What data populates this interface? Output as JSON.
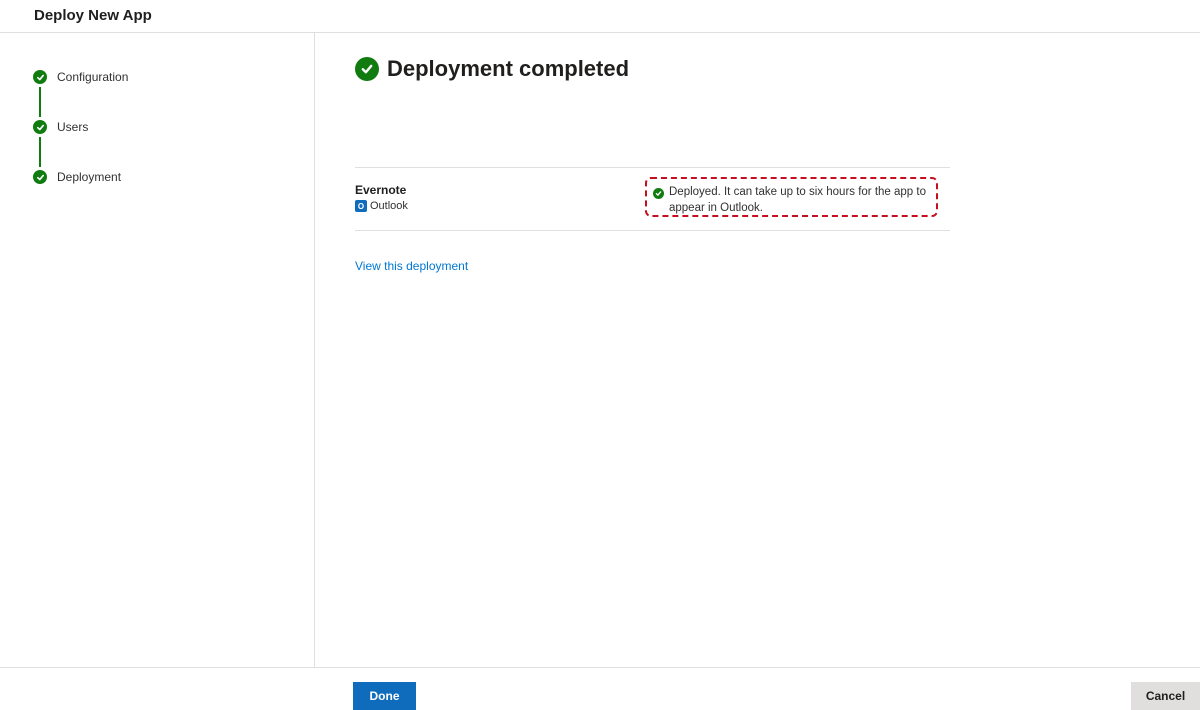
{
  "header": {
    "title": "Deploy New App"
  },
  "steps": [
    {
      "label": "Configuration",
      "icon": "check-circle-icon",
      "status": "complete"
    },
    {
      "label": "Users",
      "icon": "check-circle-icon",
      "status": "complete"
    },
    {
      "label": "Deployment",
      "icon": "check-circle-icon",
      "status": "complete"
    }
  ],
  "main": {
    "title": "Deployment completed",
    "title_icon": "check-circle-icon",
    "app": {
      "name": "Evernote",
      "host": "Outlook",
      "host_icon": "outlook-icon",
      "status_icon": "check-circle-icon",
      "status": "Deployed. It can take up to six hours for the app to appear in Outlook."
    },
    "view_link": "View this deployment"
  },
  "footer": {
    "done_label": "Done",
    "cancel_label": "Cancel"
  },
  "colors": {
    "success": "#107c10",
    "primary": "#0f6cbd",
    "link": "#0078d4",
    "highlight": "#c50f1f"
  }
}
